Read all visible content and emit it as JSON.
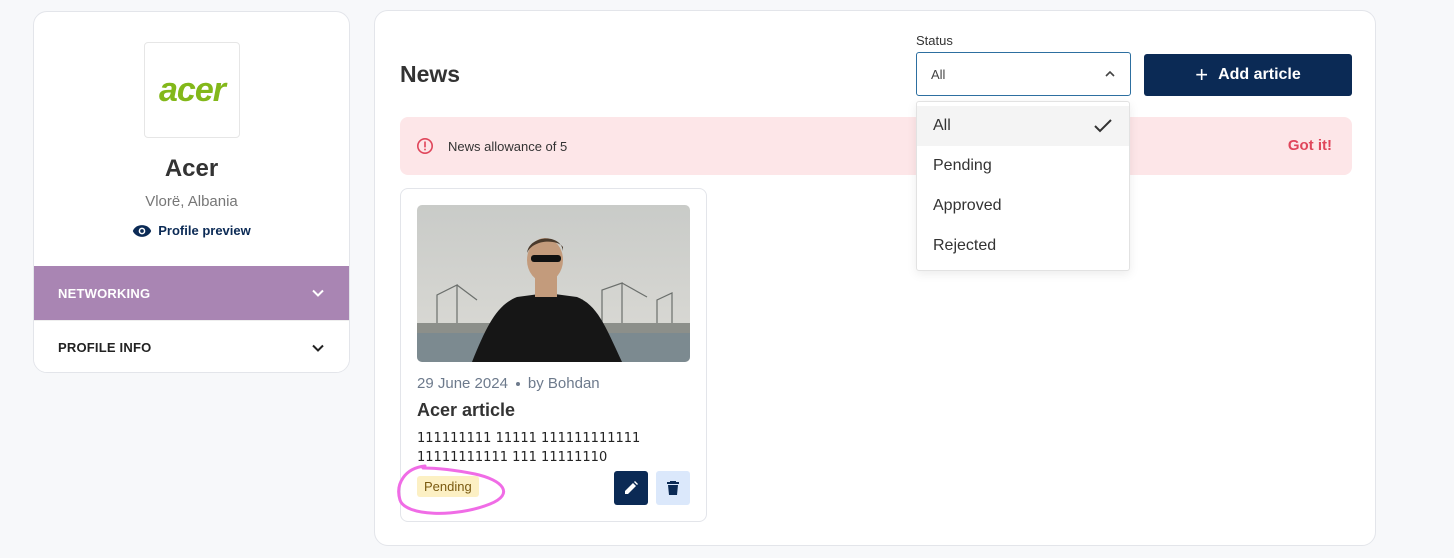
{
  "profile": {
    "logo_text": "acer",
    "name": "Acer",
    "location": "Vlorë, Albania",
    "preview_label": "Profile preview",
    "sections": [
      {
        "label": "NETWORKING",
        "active": true
      },
      {
        "label": "PROFILE INFO",
        "active": false
      }
    ]
  },
  "main": {
    "title": "News",
    "status_filter": {
      "label": "Status",
      "value": "All",
      "options": [
        {
          "label": "All",
          "selected": true
        },
        {
          "label": "Pending",
          "selected": false
        },
        {
          "label": "Approved",
          "selected": false
        },
        {
          "label": "Rejected",
          "selected": false
        }
      ]
    },
    "add_button_label": "Add article",
    "alert": {
      "message": "News allowance of 5",
      "action_label": "Got it!"
    },
    "articles": [
      {
        "date": "29 June 2024",
        "author": "by Bohdan",
        "title": "Acer article",
        "body_line1": "111111111 11111 111111111111",
        "body_line2": "11111111111 111 11111110",
        "status": "Pending"
      }
    ]
  },
  "colors": {
    "primary": "#0b2a55",
    "networking_bg": "#a985b3",
    "alert_bg": "#fde6e8",
    "alert_accent": "#e0465b",
    "badge_bg": "#fcf0c4",
    "annotation": "#f06ce6"
  },
  "icons": [
    "eye-icon",
    "chevron-down-icon",
    "chevron-up-icon",
    "plus-icon",
    "alert-circle-icon",
    "check-icon",
    "pencil-icon",
    "trash-icon"
  ]
}
